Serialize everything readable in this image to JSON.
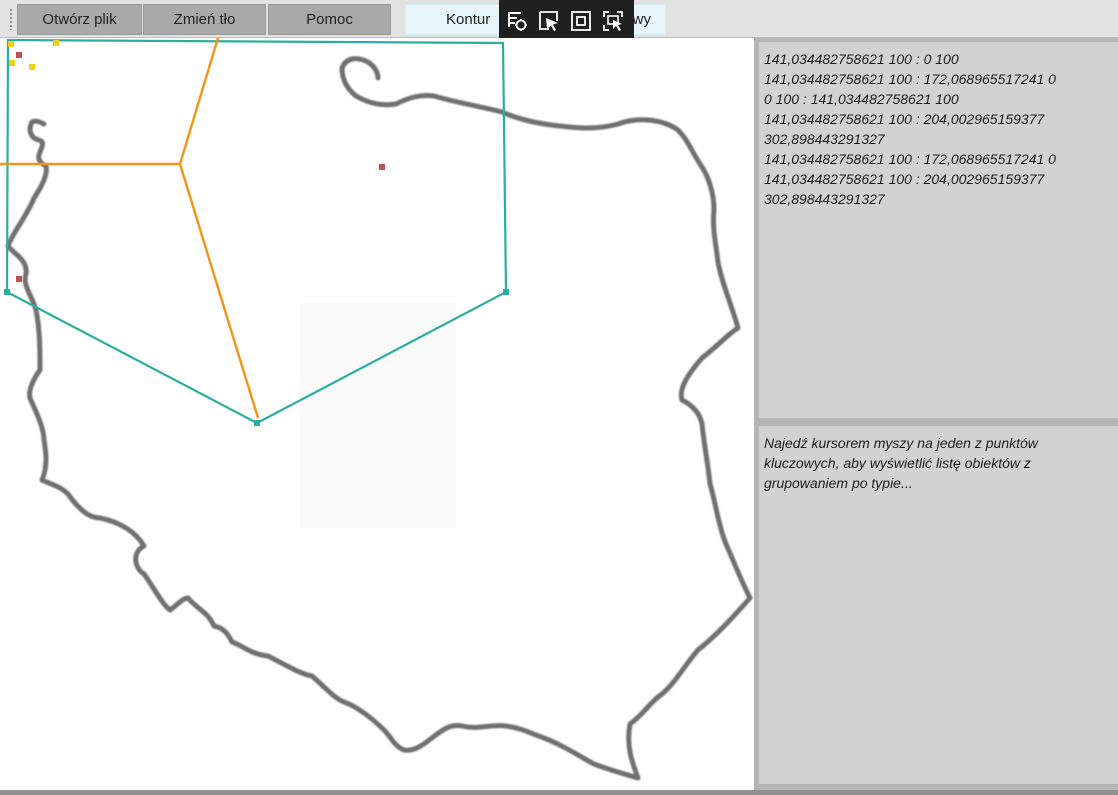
{
  "toolbar": {
    "buttons": [
      {
        "id": "open",
        "label": "Otwórz plik"
      },
      {
        "id": "bg",
        "label": "Zmień tło"
      },
      {
        "id": "help",
        "label": "Pomoc"
      },
      {
        "id": "kontur",
        "label": "Kontur"
      },
      {
        "id": "second",
        "label": "owy"
      }
    ]
  },
  "debug_toolbar": {
    "icons": [
      "live-visual-tree-icon",
      "select-element-icon",
      "display-layout-adorners-icon",
      "track-focused-element-icon"
    ]
  },
  "coordinates_panel": {
    "lines": [
      "141,034482758621 100 : 0 100",
      "141,034482758621 100 : 172,068965517241 0",
      "0 100 : 141,034482758621 100",
      "141,034482758621 100 : 204,002965159377 302,898443291327",
      "141,034482758621 100 : 172,068965517241 0",
      "141,034482758621 100 : 204,002965159377 302,898443291327"
    ]
  },
  "info_panel": {
    "text": "Najedź kursorem myszy na jeden z punktów kluczowych, aby wyświetlić listę obiektów z grupowaniem po typie..."
  },
  "colors": {
    "contour_line": "#2bada3",
    "voronoi_line": "#f39417",
    "key_point": "#c0504d",
    "highlight_point": "#f2d017",
    "border_outline": "#6f6f6f"
  }
}
